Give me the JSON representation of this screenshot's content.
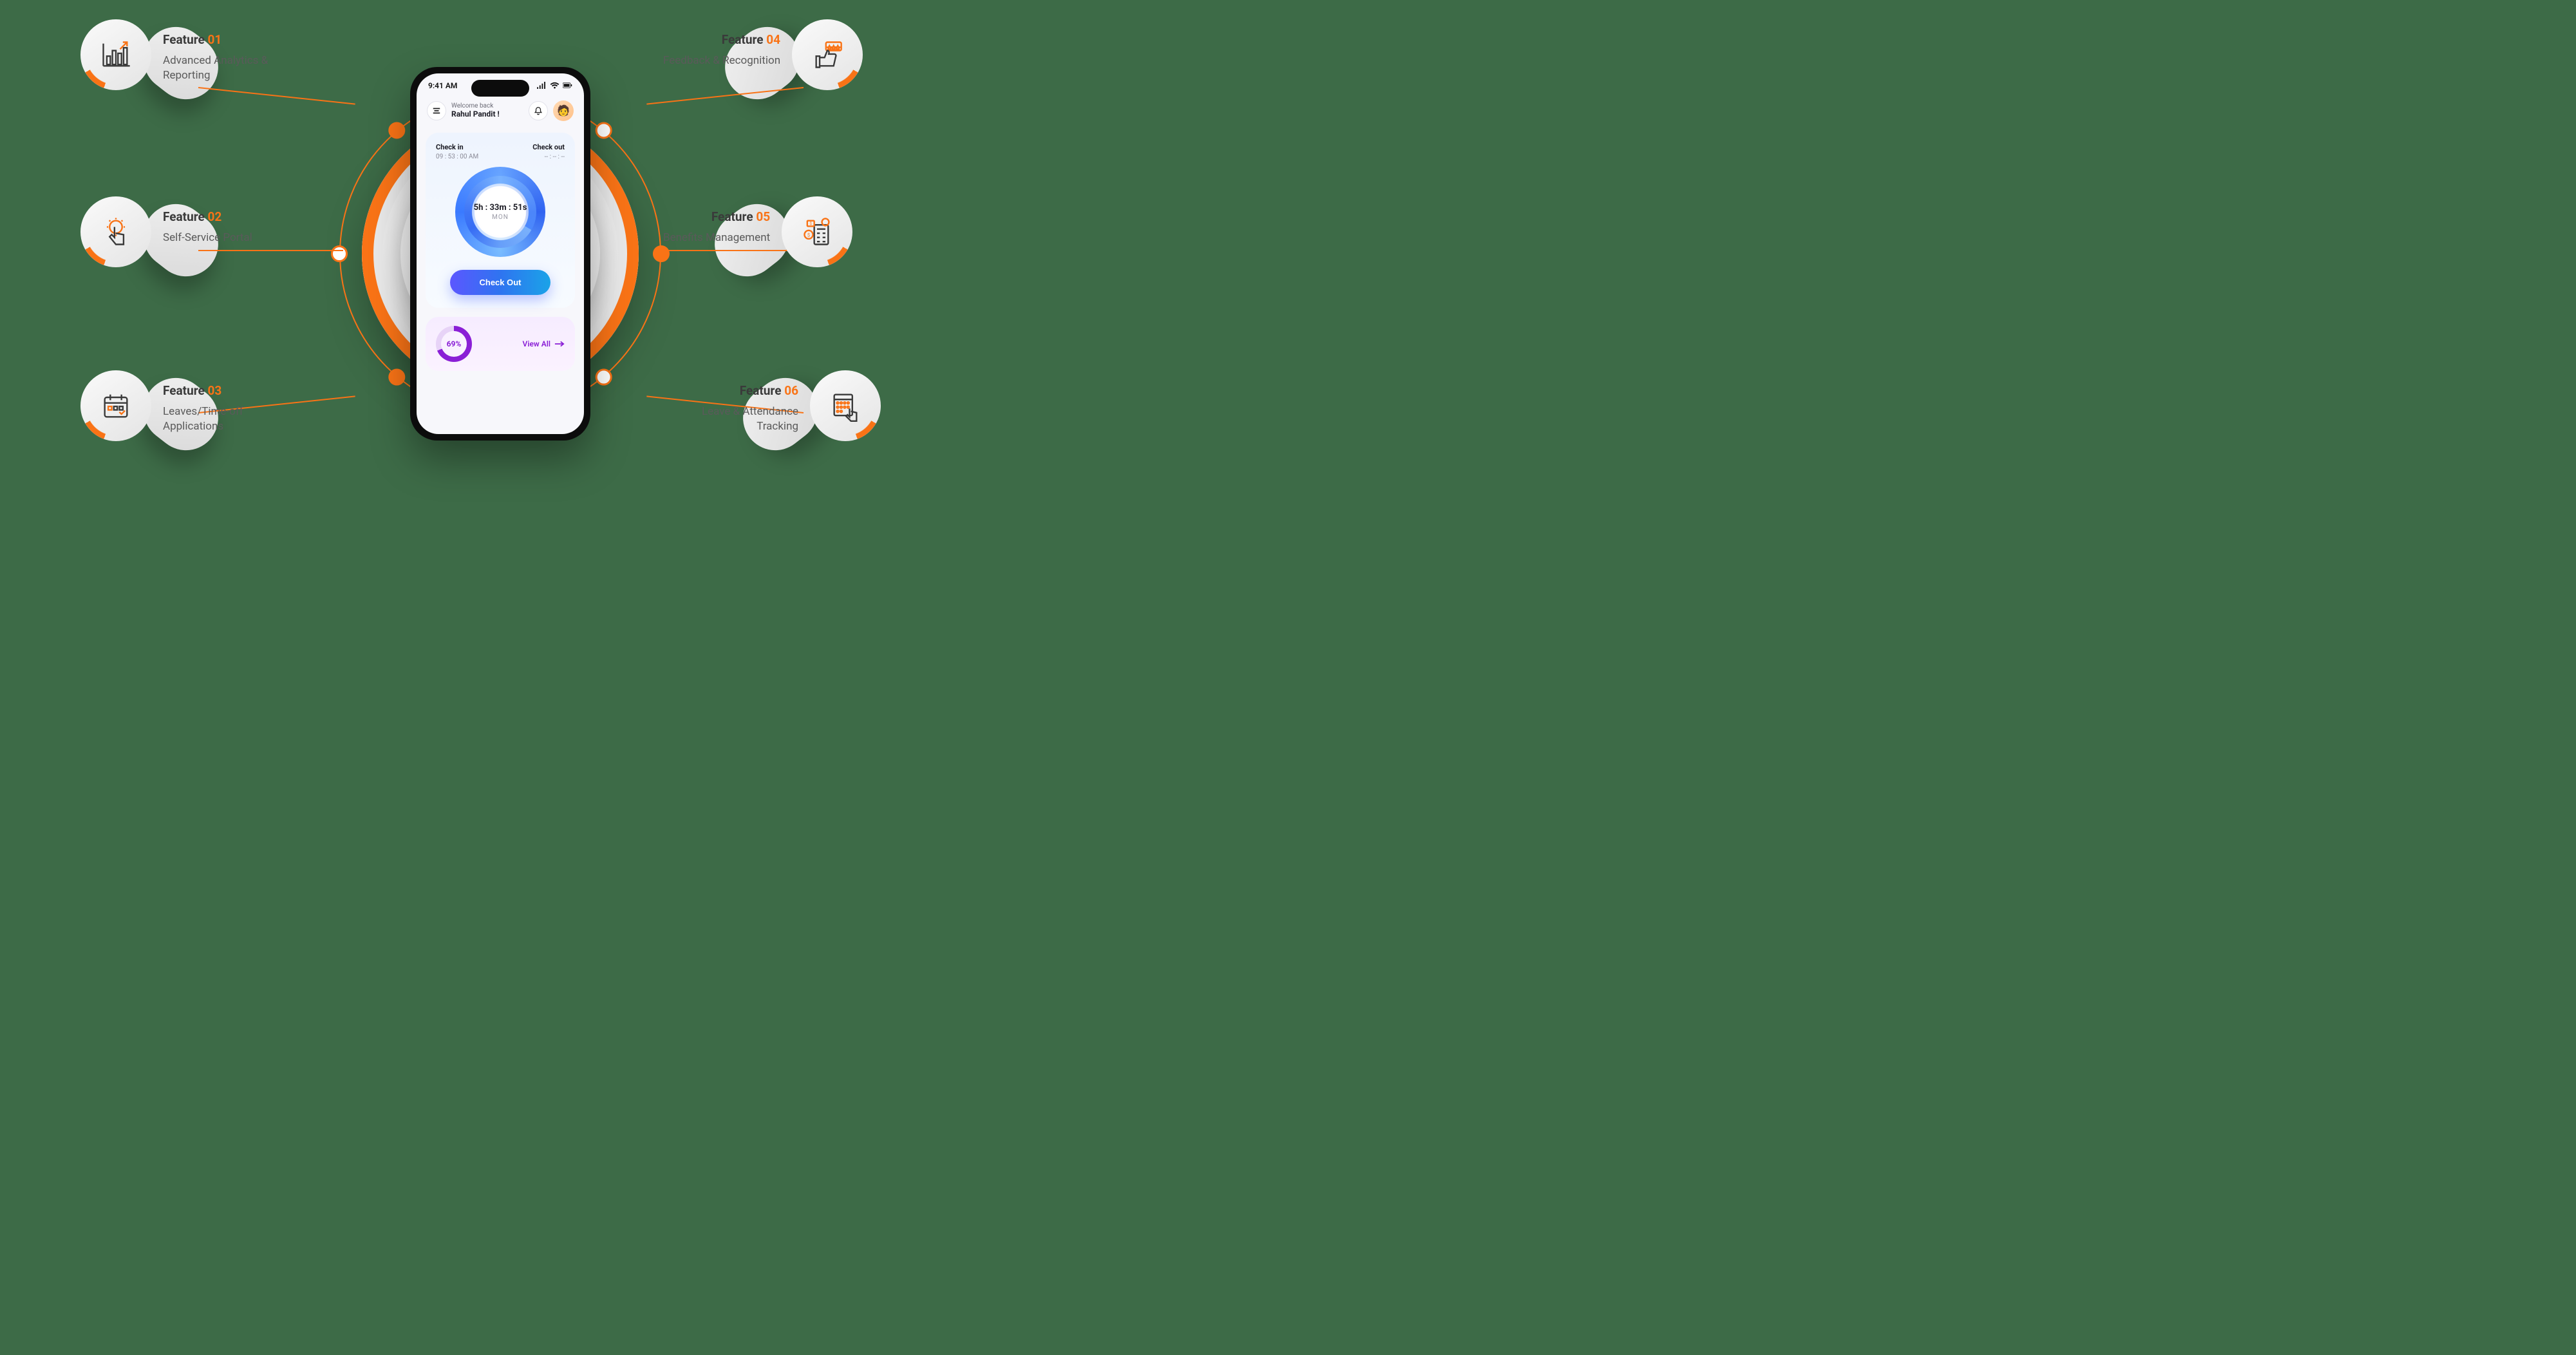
{
  "features": [
    {
      "prefix": "Feature ",
      "num": "01",
      "desc": "Advanced Analytics & Reporting"
    },
    {
      "prefix": "Feature ",
      "num": "02",
      "desc": "Self-Service Portal"
    },
    {
      "prefix": "Feature ",
      "num": "03",
      "desc": "Leaves/Time-off Applications"
    },
    {
      "prefix": "Feature ",
      "num": "04",
      "desc": "Feedback & Recognition"
    },
    {
      "prefix": "Feature ",
      "num": "05",
      "desc": "Benefits Management"
    },
    {
      "prefix": "Feature ",
      "num": "06",
      "desc": "Leave & Attendance Tracking"
    }
  ],
  "phone": {
    "status_time": "9:41 AM",
    "welcome_label": "Welcome back",
    "user_name": "Rahul Pandit !",
    "checkin_label": "Check in",
    "checkin_time": "09 : 53 : 00 AM",
    "checkout_label": "Check out",
    "checkout_time": "-- : -- : --",
    "elapsed": "5h : 33m : 51s",
    "day": "MON",
    "checkout_btn": "Check Out",
    "progress_pct": "69%",
    "view_all": "View All"
  }
}
